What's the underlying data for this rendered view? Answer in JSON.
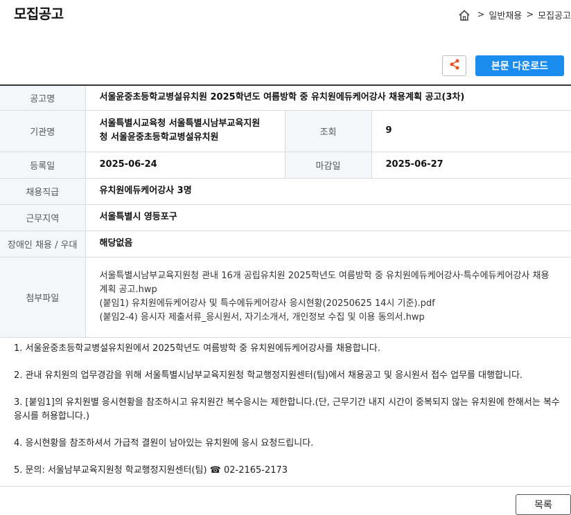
{
  "page_title": "모집공고",
  "breadcrumb": {
    "items": [
      "일반채용",
      "모집공고"
    ],
    "separator": ">"
  },
  "actions": {
    "download_label": "본문 다운로드",
    "list_label": "목록"
  },
  "colors": {
    "accent": "#1a8cf0",
    "share_icon": "#e8541e"
  },
  "info": {
    "title_label": "공고명",
    "title_value": "서울윤중초등학교병설유치원 2025학년도 여름방학 중 유치원에듀케어강사 채용계획 공고(3차)",
    "org_label": "기관명",
    "org_value_line1": "서울특별시교육청 서울특별시남부교육지원",
    "org_value_line2": "청 서울윤중초등학교병설유치원",
    "views_label": "조회",
    "views_value": "9",
    "reg_label": "등록일",
    "reg_value": "2025-06-24",
    "deadline_label": "마감일",
    "deadline_value": "2025-06-27",
    "position_label": "채용직급",
    "position_value": "유치원에듀케어강사 3명",
    "region_label": "근무지역",
    "region_value": "서울특별시 영등포구",
    "disability_label": "장애인 채용 / 우대",
    "disability_value": "해당없음",
    "attach_label": "첨부파일",
    "attachments": [
      "서울특별시남부교육지원청 관내 16개 공립유치원 2025학년도 여름방학 중 유치원에듀케어강사·특수에듀케어강사 채용",
      "계획 공고.hwp",
      "(붙임1) 유치원에듀케어강사 및 특수에듀케어강사 응시현황(20250625 14시 기준).pdf",
      "(붙임2-4) 응시자 제출서류_응시원서, 자기소개서, 개인정보 수집 및 이용 동의서.hwp"
    ]
  },
  "body": [
    "1. 서울윤중초등학교병설유치원에서 2025학년도 여름방학 중 유치원에듀케어강사를 채용합니다.",
    "2. 관내 유치원의 업무경감을 위해 서울특별시남부교육지원청 학교행정지원센터(팀)에서 채용공고 및 응시원서 접수 업무를 대행합니다.",
    "3. [붙임1]의 유치원별 응시현황을 참조하시고 유치원간 복수응시는 제한합니다.(단, 근무기간 내지 시간이 중복되지 않는 유치원에 한해서는 복수응시를 허용합니다.)",
    "4. 응시현황을 참조하셔서 가급적 결원이 남아있는 유치원에 응시 요청드립니다.",
    "5. 문의: 서울남부교육지원청 학교행정지원센터(팀) ☎ 02-2165-2173"
  ]
}
